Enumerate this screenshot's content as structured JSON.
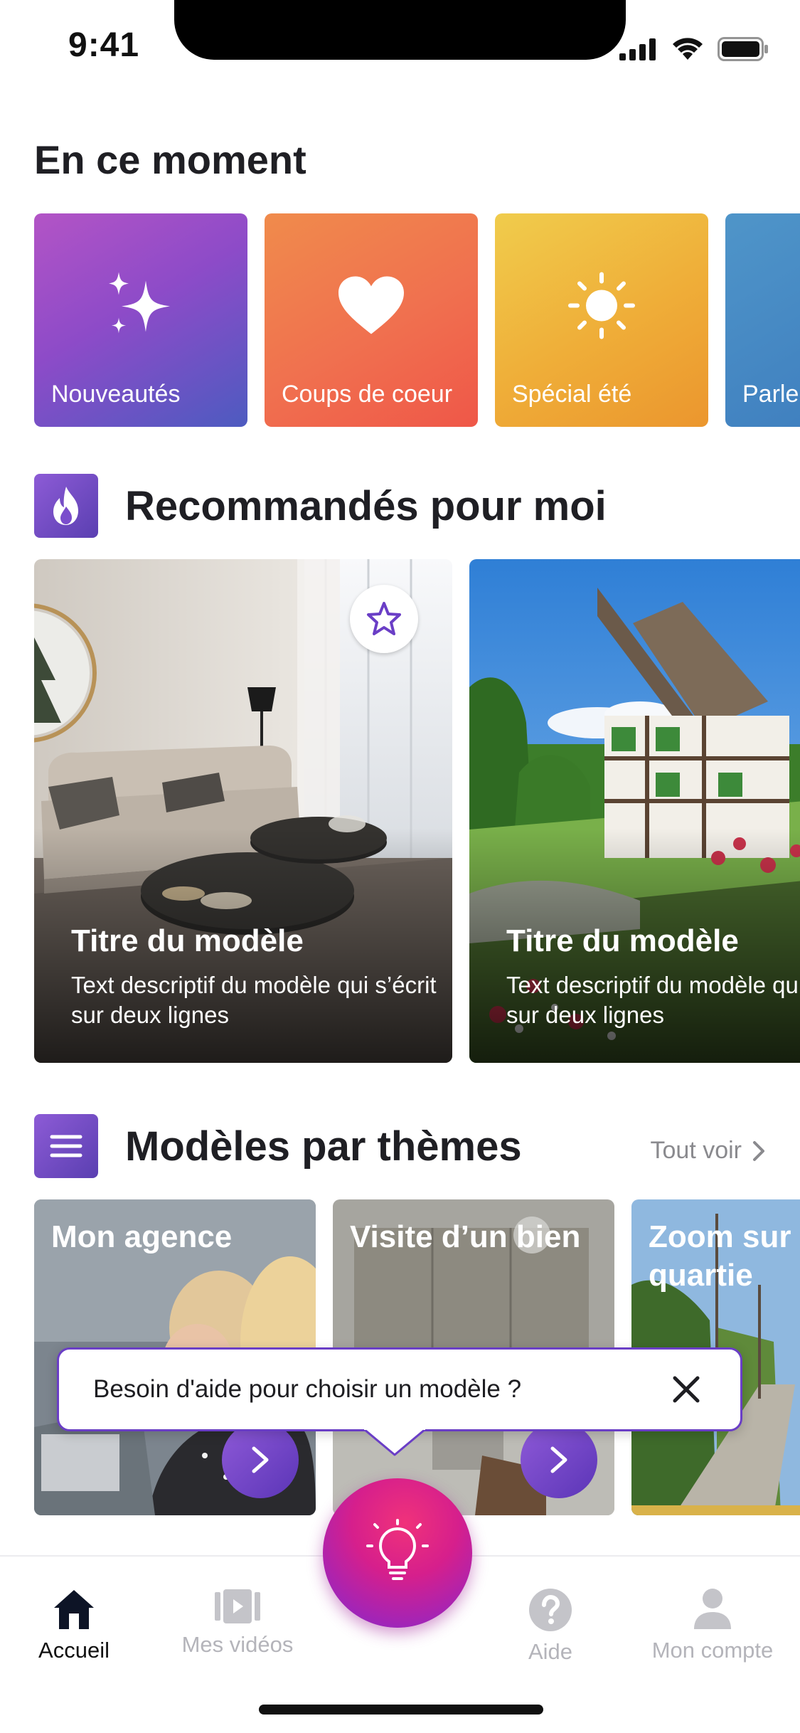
{
  "status_bar": {
    "time": "9:41"
  },
  "moment": {
    "title": "En ce moment",
    "tiles": [
      {
        "label": "Nouveautés",
        "icon": "sparkles-icon"
      },
      {
        "label": "Coups de coeur",
        "icon": "heart-icon"
      },
      {
        "label": "Spécial été",
        "icon": "sun-icon"
      },
      {
        "label": "Parle",
        "icon": ""
      }
    ]
  },
  "recommended": {
    "title": "Recommandés pour moi",
    "icon": "flame-icon",
    "cards": [
      {
        "title": "Titre du modèle",
        "description": "Text descriptif du modèle qui s’écrit sur deux lignes"
      },
      {
        "title": "Titre du modèle",
        "description": "Text descriptif du modèle qui s’écrit sur deux lignes"
      }
    ]
  },
  "themes": {
    "title": "Modèles par thèmes",
    "icon": "menu-icon",
    "see_all": "Tout voir",
    "cards": [
      {
        "title": "Mon agence"
      },
      {
        "title": "Visite d’un bien"
      },
      {
        "title": "Zoom sur un quartie"
      }
    ]
  },
  "help_bubble": {
    "text": "Besoin d'aide pour choisir un modèle ?"
  },
  "tab_bar": {
    "tabs": [
      {
        "label": "Accueil",
        "icon": "home-icon",
        "active": true
      },
      {
        "label": "Mes vidéos",
        "icon": "video-icon",
        "active": false
      },
      {
        "label": "Aide",
        "icon": "help-icon",
        "active": false
      },
      {
        "label": "Mon compte",
        "icon": "user-icon",
        "active": false
      }
    ],
    "center_button_icon": "lightbulb-icon"
  },
  "colors": {
    "accent_purple": "#6a3ec6",
    "fab_pink": "#e0217f"
  }
}
